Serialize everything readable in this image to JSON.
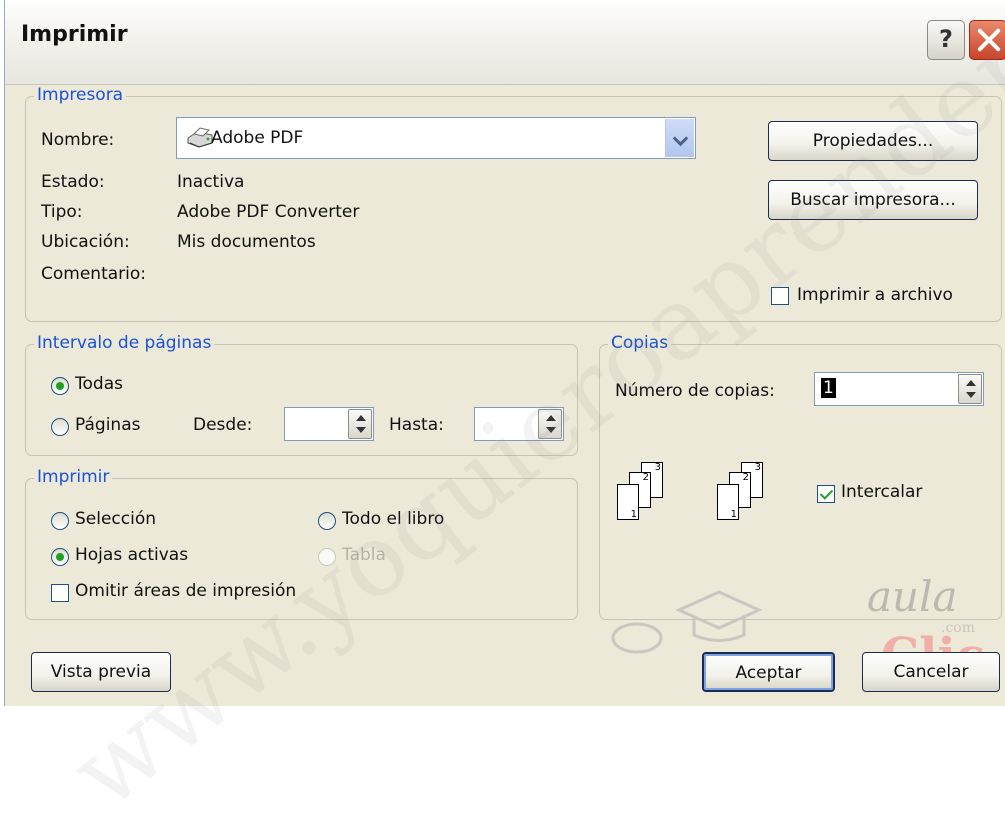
{
  "dialog": {
    "title": "Imprimir",
    "help_label": "?"
  },
  "printer": {
    "legend": "Impresora",
    "name_label": "Nombre:",
    "name_value": "Adobe PDF",
    "status_label": "Estado:",
    "status_value": "Inactiva",
    "type_label": "Tipo:",
    "type_value": "Adobe PDF Converter",
    "location_label": "Ubicación:",
    "location_value": "Mis documentos",
    "comment_label": "Comentario:",
    "properties_button": "Propiedades...",
    "find_button": "Buscar impresora...",
    "print_to_file": {
      "label": "Imprimir a archivo",
      "checked": false
    }
  },
  "range": {
    "legend": "Intervalo de páginas",
    "all_label": "Todas",
    "all_selected": true,
    "pages_label": "Páginas",
    "from_label": "Desde:",
    "from_value": "",
    "to_label": "Hasta:",
    "to_value": ""
  },
  "print_what": {
    "legend": "Imprimir",
    "selection_label": "Selección",
    "active_sheets_label": "Hojas activas",
    "active_sheets_selected": true,
    "entire_workbook_label": "Todo el libro",
    "table_label": "Tabla",
    "ignore_print_areas": {
      "label": "Omitir áreas de impresión",
      "checked": false
    }
  },
  "copies": {
    "legend": "Copias",
    "number_label": "Número de copias:",
    "number_value": "1",
    "collate": {
      "label": "Intercalar",
      "checked": true
    },
    "collate_pages": [
      "1",
      "2",
      "3"
    ]
  },
  "footer": {
    "preview_button": "Vista previa",
    "ok_button": "Aceptar",
    "cancel_button": "Cancelar"
  },
  "watermark": {
    "url_text": "www.yoquieroaprender.com",
    "logo_top": "aula",
    "logo_sub": ".com",
    "logo_bottom": "Clic"
  },
  "colors": {
    "accent": "#1a51d6",
    "dialog_bg": "#ece9d8",
    "close_button": "#c9432a",
    "check_green": "#21a121"
  }
}
